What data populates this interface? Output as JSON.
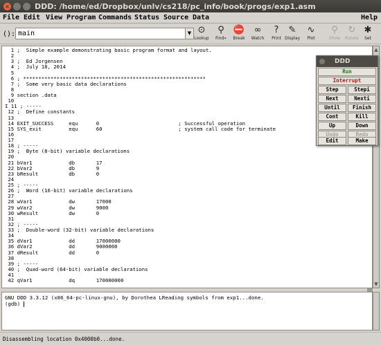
{
  "window": {
    "title": "DDD: /home/ed/Dropbox/unlv/cs218/pc_info/book/progs/exp1.asm"
  },
  "menu": {
    "file": "File",
    "edit": "Edit",
    "view": "View",
    "program": "Program",
    "commands": "Commands",
    "status": "Status",
    "source": "Source",
    "data": "Data",
    "help": "Help"
  },
  "toolbar": {
    "arg_label": "():",
    "arg_value": "main",
    "tools": [
      {
        "label": "Lookup",
        "icon": "lookup-icon",
        "glyph": "⊙",
        "enabled": true
      },
      {
        "label": "Find»",
        "icon": "find-icon",
        "glyph": "⚲",
        "enabled": true
      },
      {
        "label": "Break",
        "icon": "break-icon",
        "glyph": "⛔",
        "enabled": true
      },
      {
        "label": "Watch",
        "icon": "watch-icon",
        "glyph": "∞",
        "enabled": true
      },
      {
        "label": "Print",
        "icon": "print-icon",
        "glyph": "?",
        "enabled": true
      },
      {
        "label": "Display",
        "icon": "display-icon",
        "glyph": "✎",
        "enabled": true
      },
      {
        "label": "Plot",
        "icon": "plot-icon",
        "glyph": "∿",
        "enabled": true
      },
      {
        "label": "Show",
        "icon": "show-icon",
        "glyph": "⚲",
        "enabled": false
      },
      {
        "label": "Rotate",
        "icon": "rotate-icon",
        "glyph": "↻",
        "enabled": false
      },
      {
        "label": "Set",
        "icon": "set-icon",
        "glyph": "✱",
        "enabled": true
      },
      {
        "label": "Undisp",
        "icon": "undisp-icon",
        "glyph": "✂",
        "enabled": false
      }
    ]
  },
  "source_lines": [
    "  1 ;  Simple example demonstrating basic program format and layout.",
    "  2",
    "  3 ;  Ed Jorgensen",
    "  4 ;  July 18, 2014",
    "  5",
    "  6 ; ************************************************************",
    "  7 ;  Some very basic data declarations",
    "  8",
    "  9 section .data",
    " 10",
    "I 11 ; -----",
    " 12 ;  Define constants",
    " 13",
    " 14 EXIT_SUCCESS     equ      0                          ; Successful operation",
    " 15 SYS_exit         equ      60                         ; system call code for terminate",
    " 16",
    " 17",
    " 18 ; -----",
    " 19 ;  Byte (8-bit) variable declarations",
    " 20",
    " 21 bVar1            db       17",
    " 22 bVar2            db       9",
    " 23 bResult          db       0",
    " 24",
    " 25 ; -----",
    " 26 ;  Word (16-bit) variable declarations",
    " 27",
    " 28 wVar1            dw       17000",
    " 29 wVar2            dw       9000",
    " 30 wResult          dw       0",
    " 31",
    " 32 ; -----",
    " 33 ;  Double-word (32-bit) variable declarations",
    " 34",
    " 35 dVar1            dd       17000000",
    " 36 dVar2            dd       9000000",
    " 37 dResult          dd       0",
    " 38",
    " 39 ; -----",
    " 40 ;  Quad-word (64-bit) variable declarations",
    " 41",
    " 42 qVar1            dq       170000000"
  ],
  "console": {
    "line1": "GNU DDD 3.3.12 (x86_64-pc-linux-gnu), by Dorothea LReading symbols from exp1...done.",
    "prompt": "(gdb) "
  },
  "status": "Disassembling location 0x4000b0...done.",
  "cmdtool": {
    "title": "DDD",
    "buttons": {
      "run": "Run",
      "interrupt": "Interrupt",
      "step": "Step",
      "stepi": "Stepi",
      "next": "Next",
      "nexti": "Nexti",
      "until": "Until",
      "finish": "Finish",
      "cont": "Cont",
      "kill": "Kill",
      "up": "Up",
      "down": "Down",
      "undo": "Undo",
      "redo": "Redo",
      "edit": "Edit",
      "make": "Make"
    }
  }
}
